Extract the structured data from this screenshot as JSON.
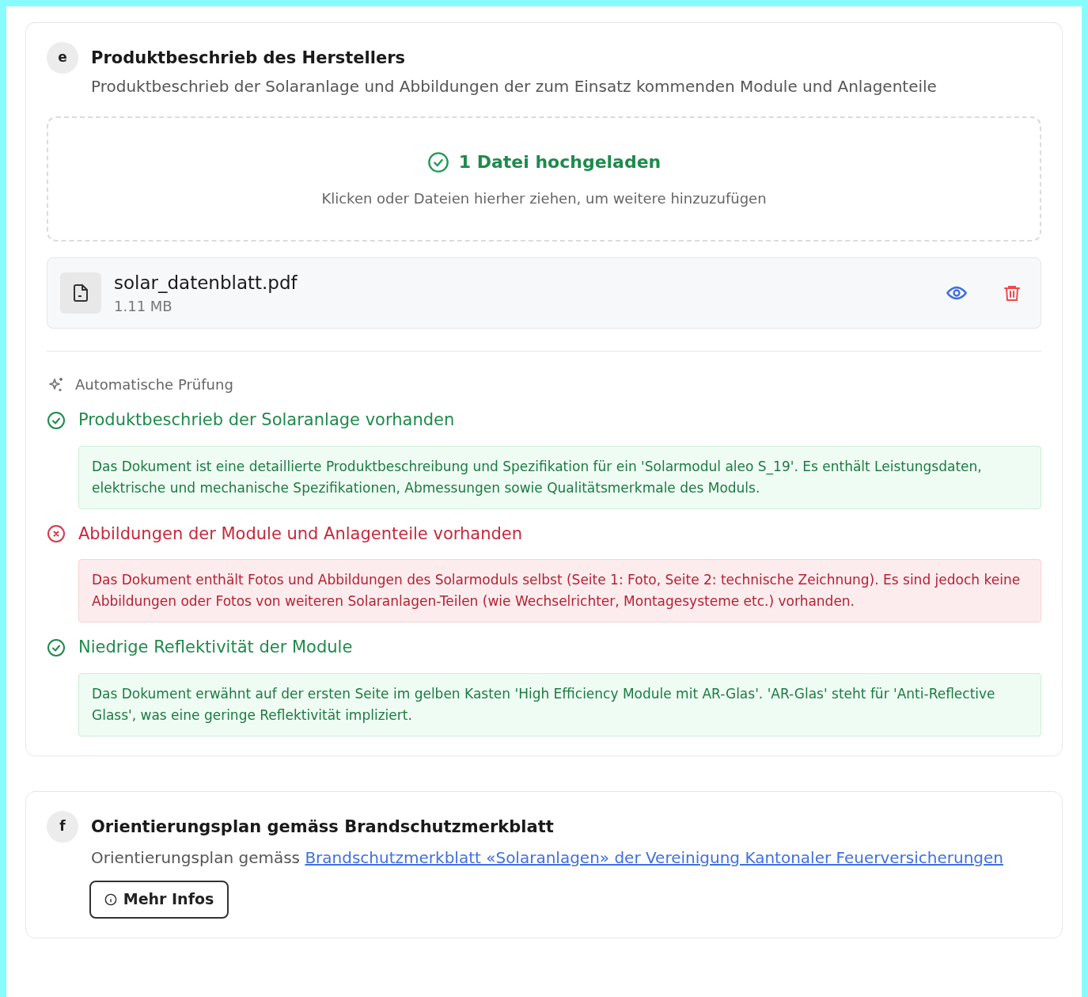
{
  "sections": [
    {
      "badge": "e",
      "title": "Produktbeschrieb des Herstellers",
      "description": "Produktbeschrieb der Solaranlage und Abbildungen der zum Einsatz kommenden Module und Anlagenteile",
      "dropzone": {
        "status": "1 Datei hochgeladen",
        "hint": "Klicken oder Dateien hierher ziehen, um weitere hinzuzufügen"
      },
      "files": [
        {
          "name": "solar_datenblatt.pdf",
          "size": "1.11 MB"
        }
      ],
      "review": {
        "heading": "Automatische Prüfung",
        "checks": [
          {
            "kind": "pass",
            "title": "Produktbeschrieb der Solaranlage vorhanden",
            "detail": "Das Dokument ist eine detaillierte Produktbeschreibung und Spezifikation für ein 'Solarmodul aleo S_19'. Es enthält Leistungsdaten, elektrische und mechanische Spezifikationen, Abmessungen sowie Qualitätsmerkmale des Moduls."
          },
          {
            "kind": "fail",
            "title": "Abbildungen der Module und Anlagenteile vorhanden",
            "detail": "Das Dokument enthält Fotos und Abbildungen des Solarmoduls selbst (Seite 1: Foto, Seite 2: technische Zeichnung). Es sind jedoch keine Abbildungen oder Fotos von weiteren Solaranlagen-Teilen (wie Wechselrichter, Montagesysteme etc.) vorhanden."
          },
          {
            "kind": "pass",
            "title": "Niedrige Reflektivität der Module",
            "detail": "Das Dokument erwähnt auf der ersten Seite im gelben Kasten 'High Efficiency Module mit AR-Glas'. 'AR-Glas' steht für 'Anti-Reflective Glass', was eine geringe Reflektivität impliziert."
          }
        ]
      }
    },
    {
      "badge": "f",
      "title": "Orientierungsplan gemäss Brandschutzmerkblatt",
      "description": "Orientierungsplan gemäss ",
      "link": "Brandschutzmerkblatt «Solaranlagen» der Vereinigung Kantonaler Feuerversicherungen",
      "button": "Mehr Infos"
    }
  ]
}
